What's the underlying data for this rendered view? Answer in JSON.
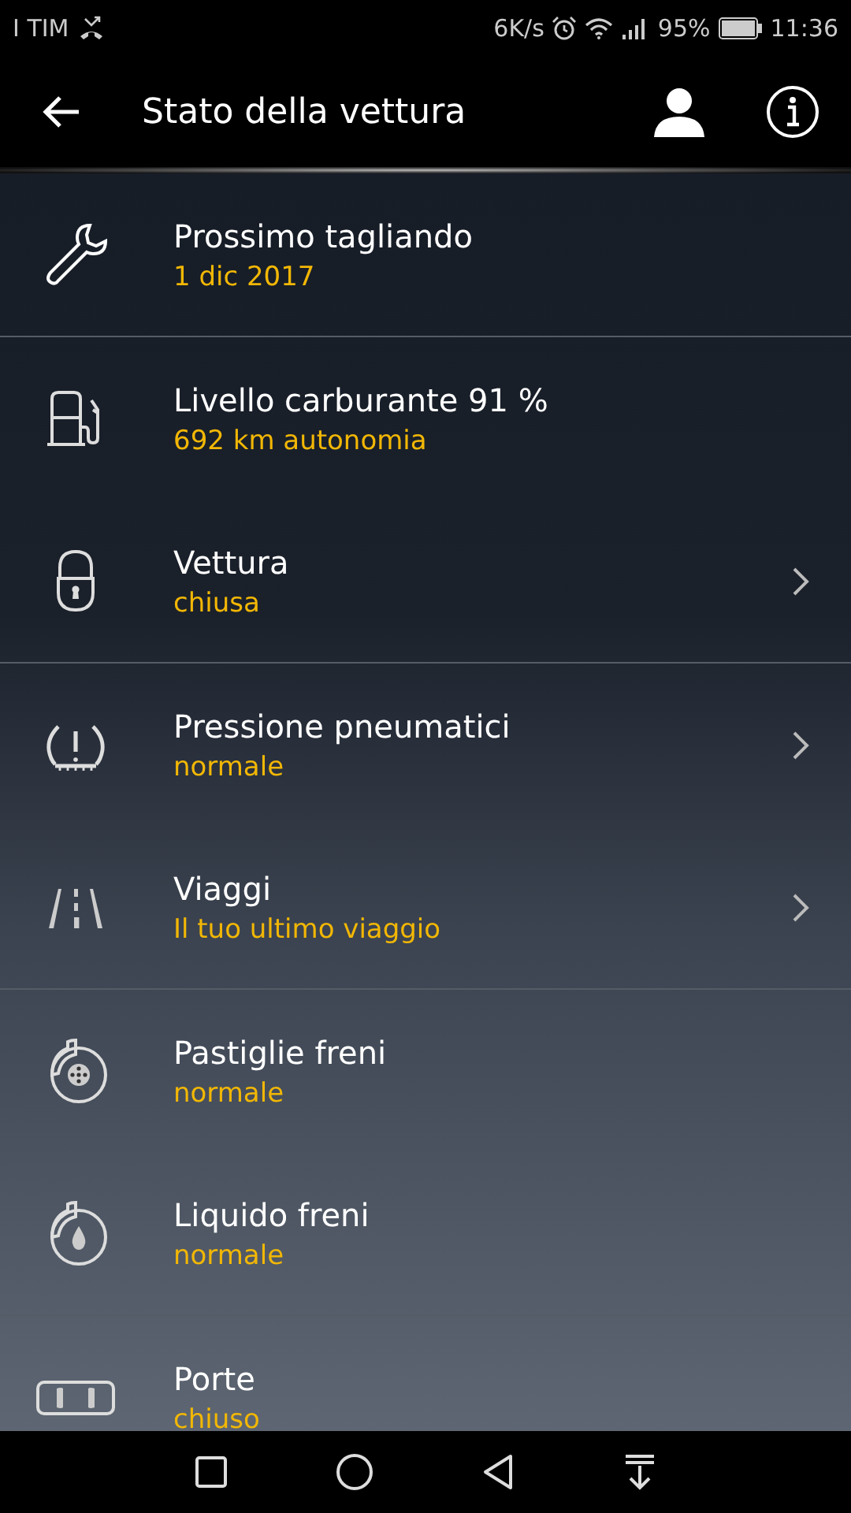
{
  "status_bar": {
    "carrier": "I TIM",
    "speed": "6K/s",
    "battery": "95%",
    "time": "11:36"
  },
  "header": {
    "title": "Stato della vettura"
  },
  "groups": [
    {
      "items": [
        {
          "kind": "wrench",
          "title": "Prossimo tagliando",
          "subtitle": "1 dic 2017",
          "chevron": false
        }
      ]
    },
    {
      "items": [
        {
          "kind": "fuel",
          "title": "Livello carburante 91 %",
          "subtitle": "692 km autonomia",
          "chevron": false
        },
        {
          "kind": "lock",
          "title": "Vettura",
          "subtitle": "chiusa",
          "chevron": true
        }
      ]
    },
    {
      "items": [
        {
          "kind": "tire",
          "title": "Pressione pneumatici",
          "subtitle": "normale",
          "chevron": true
        },
        {
          "kind": "road",
          "title": "Viaggi",
          "subtitle": "Il tuo ultimo viaggio",
          "chevron": true
        }
      ]
    },
    {
      "items": [
        {
          "kind": "brakepad",
          "title": "Pastiglie freni",
          "subtitle": "normale",
          "chevron": false
        },
        {
          "kind": "brakefluid",
          "title": "Liquido freni",
          "subtitle": "normale",
          "chevron": false
        }
      ]
    },
    {
      "items": [
        {
          "kind": "doors",
          "title": "Porte",
          "subtitle": "chiuso",
          "chevron": false
        }
      ]
    }
  ]
}
